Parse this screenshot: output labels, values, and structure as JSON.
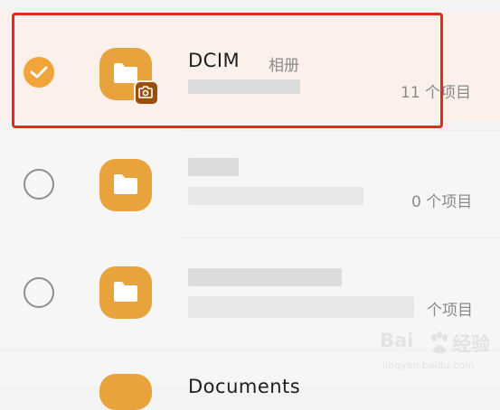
{
  "file_list": {
    "items": [
      {
        "name": "DCIM",
        "alias": "相册",
        "count": "11 个项目",
        "selected": true
      },
      {
        "name": "",
        "alias": "",
        "count": "0 个项目",
        "selected": false
      },
      {
        "name": "",
        "alias": "",
        "count": "个项目",
        "selected": false
      },
      {
        "name": "Documents",
        "alias": "",
        "count": "",
        "selected": false
      }
    ]
  },
  "watermark": {
    "brand": "Bai",
    "brand_cn": "经验",
    "url": "jingyan.baidu.com"
  },
  "colors": {
    "accent": "#f0a43a",
    "folder": "#e9a33c",
    "highlight_frame": "#e8271f",
    "selected_row_bg": "#fcf0ea"
  },
  "icons": [
    "check-icon",
    "folder-icon",
    "camera-badge-icon",
    "baidu-paw-icon"
  ]
}
